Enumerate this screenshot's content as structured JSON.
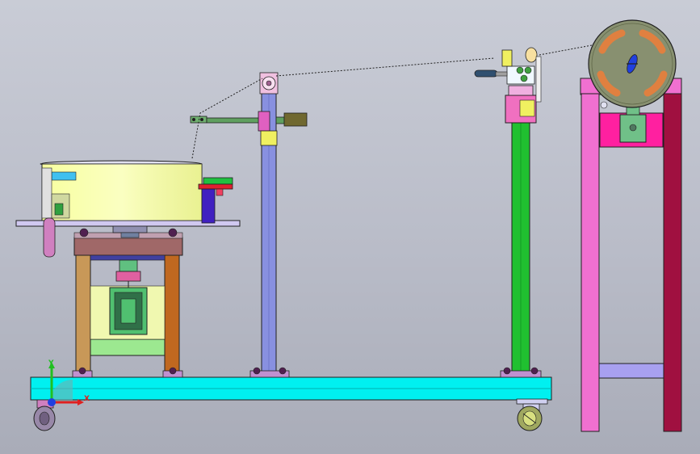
{
  "viewport": {
    "background_top": "#c9ccd6",
    "background_bottom": "#a9acb8"
  },
  "triad": {
    "x_label": "X",
    "y_label": "Y",
    "x_color": "#e02020",
    "y_color": "#20c020",
    "z_color": "#2040e0"
  },
  "colors": {
    "base_beam": "#00f0f0",
    "left_frame": "#b07838",
    "right_stand_left_leg": "#f070d0",
    "right_stand_right_leg": "#a01040",
    "right_stand_header": "#ff20a0",
    "middle_column": "#8890e0",
    "right_column": "#20c030",
    "tub": "#f8ffa0",
    "spool": "#889070",
    "spool_slots": "#e08040",
    "outline": "#202020"
  }
}
